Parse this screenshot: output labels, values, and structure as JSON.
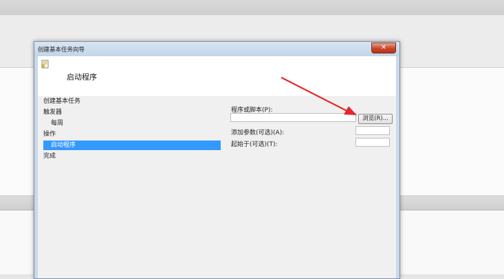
{
  "dialog": {
    "title": "创建基本任务向导",
    "close_icon": "close-icon",
    "header_title": "启动程序",
    "wizard_icon": "wizard-icon"
  },
  "nav": {
    "items": [
      {
        "label": "创建基本任务"
      },
      {
        "label": "触发器"
      },
      {
        "label": "每周"
      },
      {
        "label": "操作"
      },
      {
        "label": "启动程序",
        "selected": true
      },
      {
        "label": "完成"
      }
    ]
  },
  "form": {
    "program_label": "程序或脚本(P):",
    "program_value": "",
    "browse_label": "浏览(R)...",
    "args_label": "添加参数(可选)(A):",
    "args_value": "",
    "start_in_label": "起始于(可选)(T):",
    "start_in_value": ""
  },
  "annotation": {
    "arrow_color": "#e8262b"
  }
}
